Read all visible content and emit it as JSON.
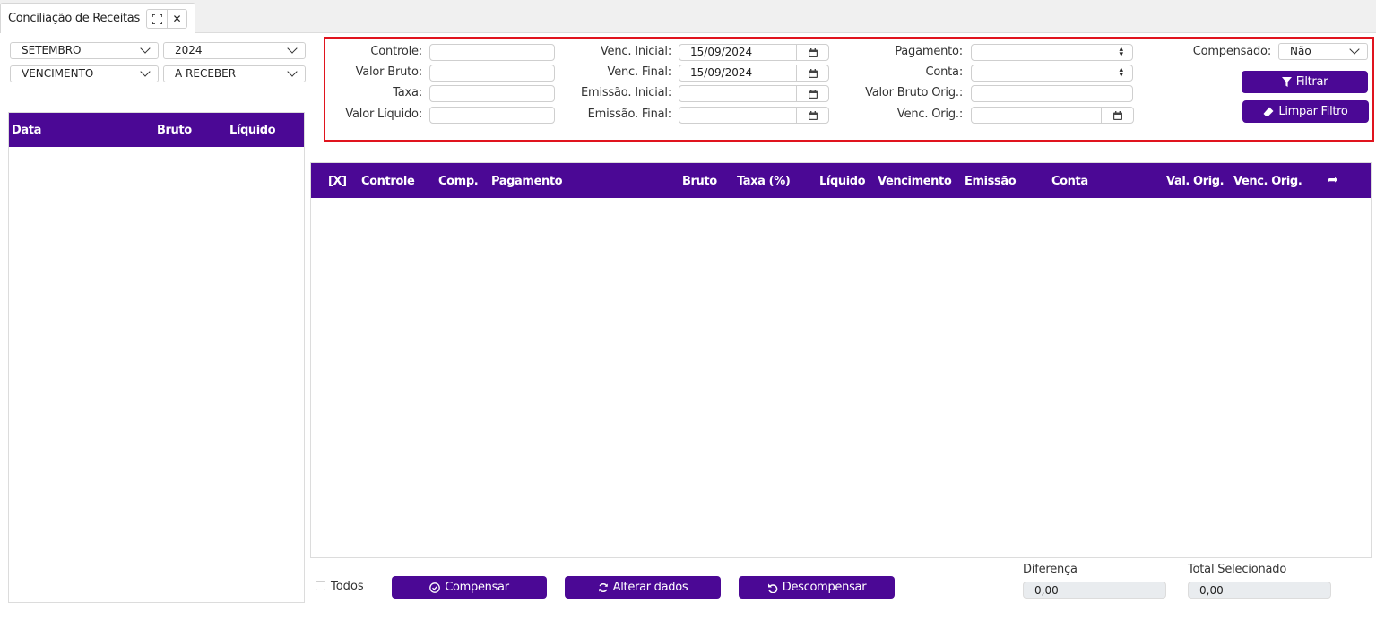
{
  "tab": {
    "title": "Conciliação de Receitas",
    "expand_icon": "expand-icon",
    "close_icon": "close-icon",
    "close_glyph": "✕"
  },
  "selectors": {
    "month": "SETEMBRO",
    "year": "2024",
    "date_type": "VENCIMENTO",
    "status": "A RECEBER"
  },
  "left_table": {
    "headers": [
      "Data",
      "Bruto",
      "Líquido"
    ],
    "rows": []
  },
  "filters": {
    "controle_label": "Controle:",
    "controle_value": "",
    "valor_bruto_label": "Valor Bruto:",
    "valor_bruto_value": "",
    "taxa_label": "Taxa:",
    "taxa_value": "",
    "valor_liquido_label": "Valor Líquido:",
    "valor_liquido_value": "",
    "venc_inicial_label": "Venc. Inicial:",
    "venc_inicial_value": "15/09/2024",
    "venc_final_label": "Venc. Final:",
    "venc_final_value": "15/09/2024",
    "emissao_inicial_label": "Emissão. Inicial:",
    "emissao_inicial_value": "",
    "emissao_final_label": "Emissão. Final:",
    "emissao_final_value": "",
    "pagamento_label": "Pagamento:",
    "pagamento_value": "",
    "conta_label": "Conta:",
    "conta_value": "",
    "valor_bruto_orig_label": "Valor Bruto Orig.:",
    "valor_bruto_orig_value": "",
    "venc_orig_label": "Venc. Orig.:",
    "venc_orig_value": "",
    "compensado_label": "Compensado:",
    "compensado_value": "Não",
    "filtrar_label": "Filtrar",
    "limpar_label": "Limpar Filtro"
  },
  "main_table": {
    "headers": [
      "[X]",
      "Controle",
      "Comp.",
      "Pagamento",
      "Bruto",
      "Taxa (%)",
      "Líquido",
      "Vencimento",
      "Emissão",
      "Conta",
      "Val. Orig.",
      "Venc. Orig."
    ],
    "share_glyph": "➦",
    "rows": []
  },
  "footer": {
    "todos_label": "Todos",
    "compensar_label": "Compensar",
    "alterar_label": "Alterar dados",
    "descompensar_label": "Descompensar",
    "diferenca_label": "Diferença",
    "diferenca_value": "0,00",
    "total_label": "Total Selecionado",
    "total_value": "0,00"
  },
  "colors": {
    "accent": "#4b0895",
    "highlight_border": "#e0141e"
  }
}
